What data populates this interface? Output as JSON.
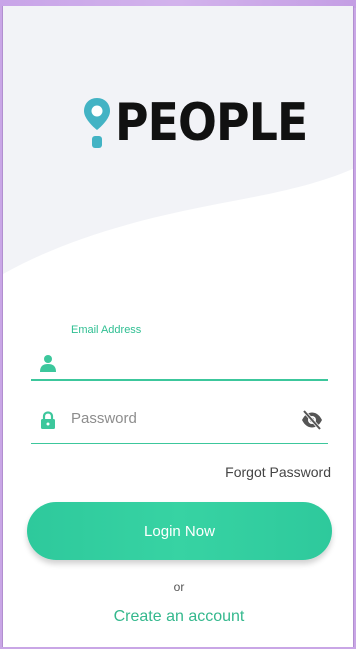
{
  "brand": {
    "name": "PEOPLE",
    "icon": "location-pin-icon",
    "accent": "#43b3c4"
  },
  "theme": {
    "primary": "#3cc79c",
    "text": "#111111"
  },
  "login_form": {
    "email": {
      "label": "Email Address",
      "value": "",
      "icon": "user-icon"
    },
    "password": {
      "placeholder": "Password",
      "icon": "lock-icon",
      "toggle_icon": "eye-off-icon"
    },
    "forgot_label": "Forgot Password",
    "submit_label": "Login Now",
    "or_label": "or",
    "create_account_label": "Create an account"
  }
}
